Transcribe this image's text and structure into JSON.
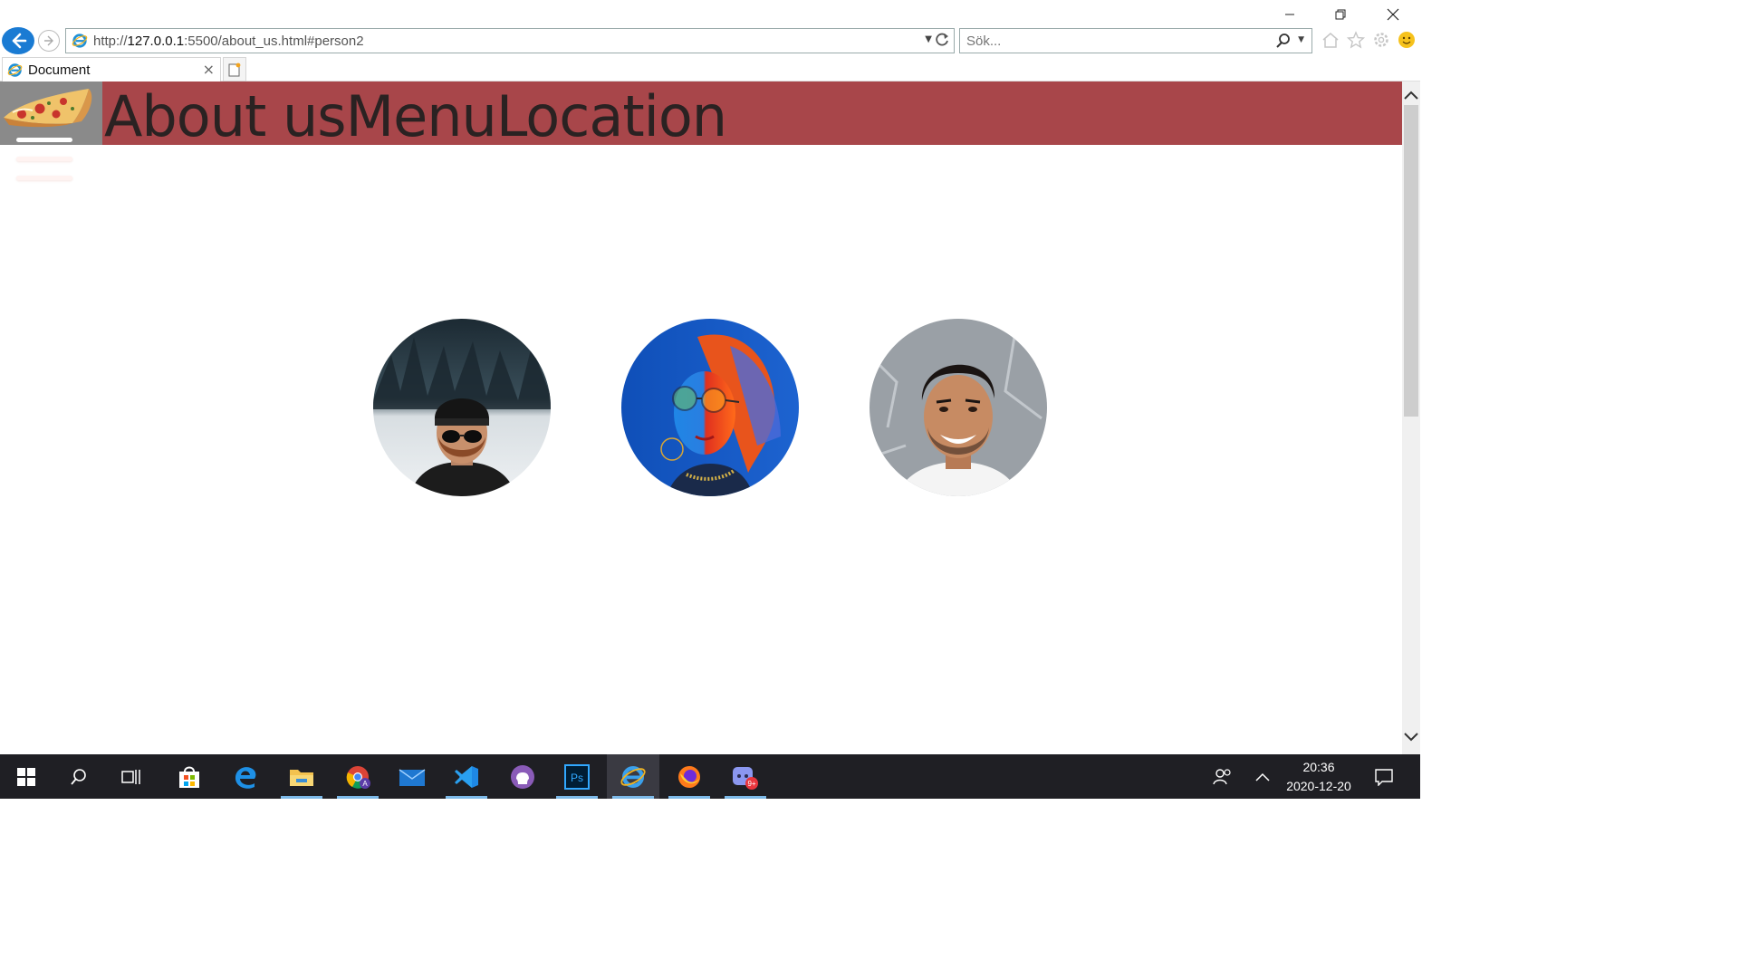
{
  "window": {
    "minimize_icon": "minimize-icon",
    "restore_icon": "restore-icon",
    "close_icon": "close-icon"
  },
  "browser": {
    "url_prefix": "http://",
    "url_host": "127.0.0.1",
    "url_rest": ":5500/about_us.html#person2",
    "search_placeholder": "Sök...",
    "tab_title": "Document",
    "tab_close": "×"
  },
  "site": {
    "header_links": [
      "About us",
      "Menu",
      "Location"
    ],
    "colors": {
      "header": "#a8464a",
      "logo_bg": "#8a8a8a"
    },
    "team": [
      {
        "name": "person1",
        "image": "man-beanie-sunglasses-snow"
      },
      {
        "name": "person2",
        "image": "woman-round-glasses-neon"
      },
      {
        "name": "person3",
        "image": "man-smiling-portrait"
      }
    ]
  },
  "taskbar": {
    "apps": [
      "start",
      "search",
      "task-view",
      "store",
      "edge",
      "file-explorer",
      "chrome",
      "mail",
      "vscode",
      "github-desktop",
      "photoshop",
      "internet-explorer",
      "firefox",
      "discord"
    ],
    "discord_badge": "9+",
    "time": "20:36",
    "date": "2020-12-20"
  }
}
